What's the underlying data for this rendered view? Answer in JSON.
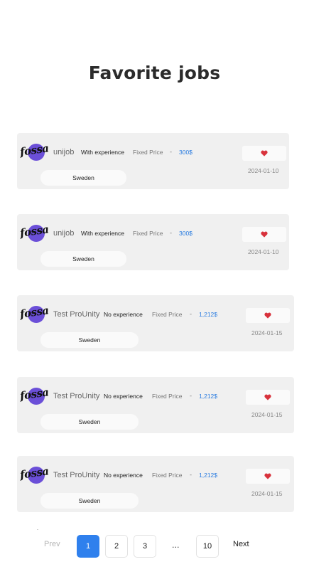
{
  "page": {
    "title": "Favorite jobs"
  },
  "jobs": [
    {
      "company": "unijob",
      "experience": "With experience",
      "price_type": "Fixed Price",
      "separator": "-",
      "price": "300$",
      "location": "Sweden",
      "date": "2024-01-10",
      "logo_text": "fossa"
    },
    {
      "company": "unijob",
      "experience": "With experience",
      "price_type": "Fixed Price",
      "separator": "-",
      "price": "300$",
      "location": "Sweden",
      "date": "2024-01-10",
      "logo_text": "fossa"
    },
    {
      "company": "Test ProUnity",
      "experience": "No experience",
      "price_type": "Fixed Price",
      "separator": "-",
      "price": "1,212$",
      "location": "Sweden",
      "date": "2024-01-15",
      "logo_text": "fossa"
    },
    {
      "company": "Test ProUnity",
      "experience": "No experience",
      "price_type": "Fixed Price",
      "separator": "-",
      "price": "1,212$",
      "location": "Sweden",
      "date": "2024-01-15",
      "logo_text": "fossa"
    },
    {
      "company": "Test ProUnity",
      "experience": "No experience",
      "price_type": "Fixed Price",
      "separator": "-",
      "price": "1,212$",
      "location": "Sweden",
      "date": "2024-01-15",
      "logo_text": "fossa"
    }
  ],
  "pagination": {
    "prev": "Prev",
    "pages": [
      "1",
      "2",
      "3",
      "10"
    ],
    "ellipsis": "...",
    "next": "Next",
    "current": "1"
  },
  "colors": {
    "accent": "#2f80ed",
    "heart": "#d8323c",
    "logo": "#6b4fd8",
    "price": "#2a7ce0"
  },
  "icons": {
    "favorite": "heart-icon",
    "brand": "fossa-logo"
  }
}
